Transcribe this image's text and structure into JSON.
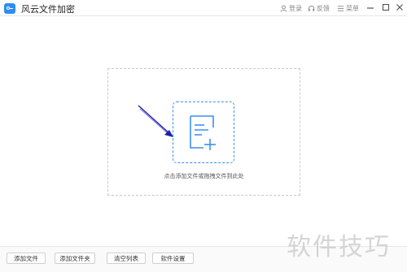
{
  "titlebar": {
    "app_title": "风云文件加密",
    "login_label": "登录",
    "feedback_label": "反馈",
    "menu_label": "菜单"
  },
  "dropzone": {
    "hint": "点击添加文件或拖拽文件到此处"
  },
  "toolbar": {
    "add_file": "添加文件",
    "add_folder": "添加文件夹",
    "clear_list": "清空列表",
    "settings": "软件设置"
  },
  "watermark": "软件技巧",
  "colors": {
    "accent": "#3a91ee",
    "arrow": "#1f1fa8"
  }
}
